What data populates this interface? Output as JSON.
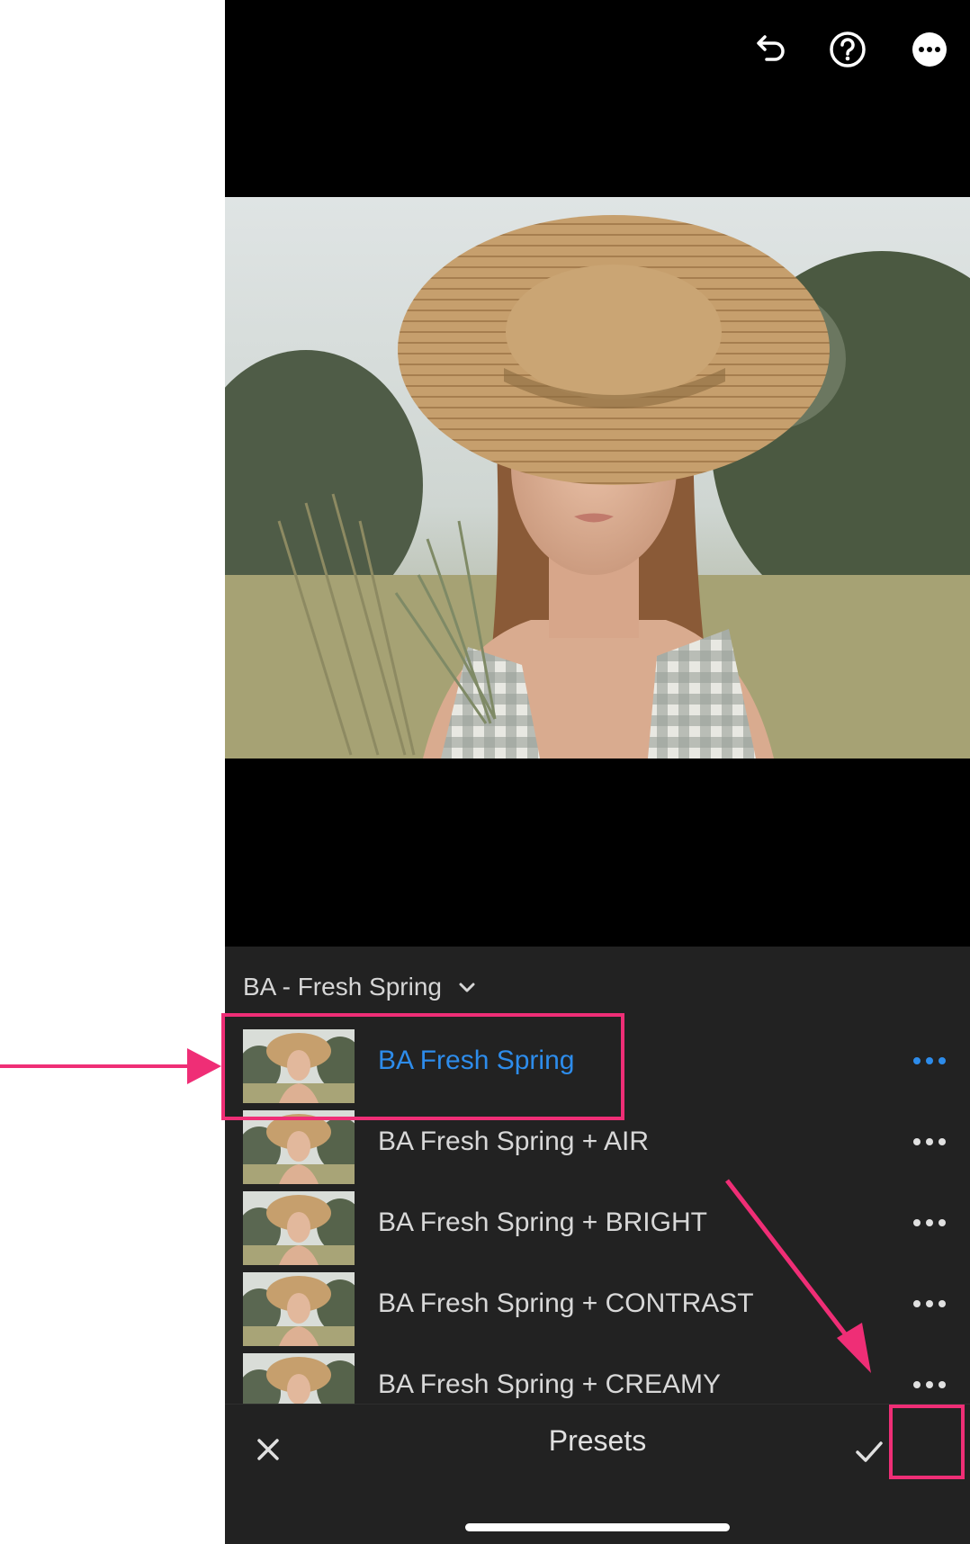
{
  "toolbar": {
    "icons": [
      "undo-icon",
      "help-icon",
      "more-options-icon"
    ]
  },
  "preset_group": {
    "label": "BA - Fresh Spring"
  },
  "presets": [
    {
      "label": "BA Fresh Spring",
      "active": true
    },
    {
      "label": "BA Fresh Spring + AIR",
      "active": false
    },
    {
      "label": "BA Fresh Spring + BRIGHT",
      "active": false
    },
    {
      "label": "BA Fresh Spring + CONTRAST",
      "active": false
    },
    {
      "label": "BA Fresh Spring + CREAMY",
      "active": false
    }
  ],
  "bottom_bar": {
    "title": "Presets",
    "close_icon": "close-icon",
    "confirm_icon": "checkmark-icon"
  },
  "colors": {
    "accent": "#2d8ceb",
    "annotation": "#ef2e76",
    "panel": "#222222"
  }
}
